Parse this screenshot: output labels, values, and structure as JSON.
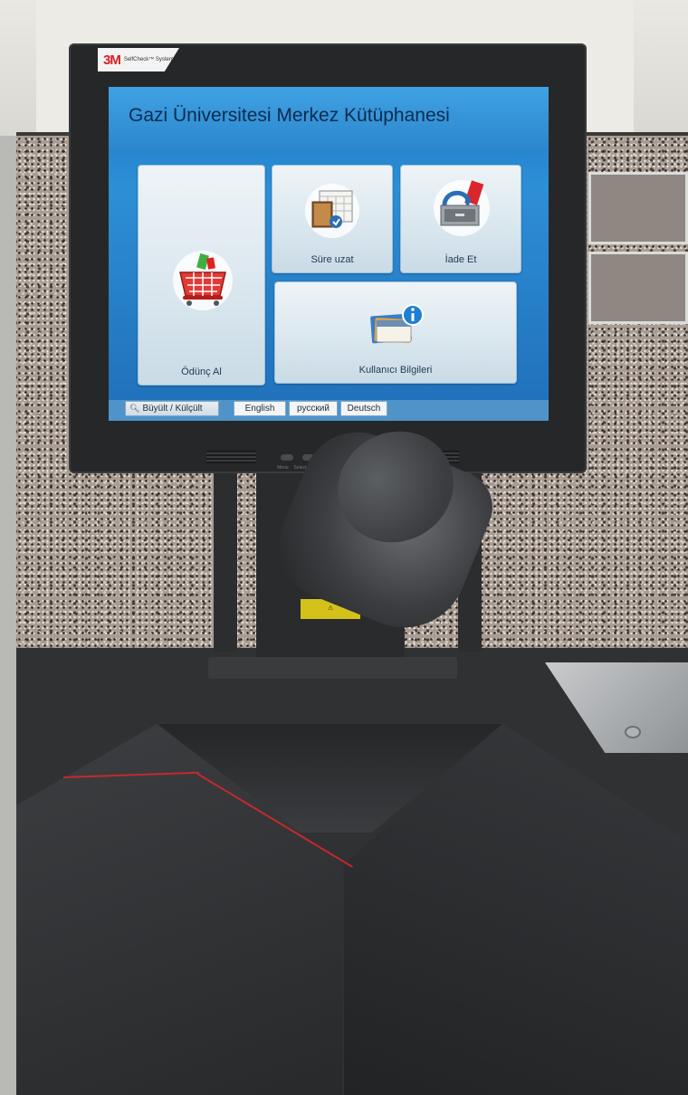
{
  "screen": {
    "title": "Gazi Üniversitesi Merkez Kütüphanesi",
    "tiles": [
      {
        "label": "Ödünç Al",
        "icon": "shopping-basket-icon"
      },
      {
        "label": "Süre uzat",
        "icon": "calendar-book-icon"
      },
      {
        "label": "İade Et",
        "icon": "return-drawer-icon"
      },
      {
        "label": "Kullanıcı Bilgileri",
        "icon": "user-info-icon"
      }
    ],
    "bottom_bar": {
      "zoom": "Büyült / Külçült",
      "languages": [
        "English",
        "русский",
        "Deutsch"
      ]
    }
  },
  "monitor": {
    "logo_mark": "3M",
    "logo_sub": "SelfCheck™ System",
    "buttons": [
      "Menu",
      "Select",
      "–",
      "+"
    ]
  },
  "colors": {
    "screen_blue": "#2c86cd",
    "tile_light": "#e4eef4",
    "brand_red": "#d62021",
    "laser_red": "#e0262a"
  }
}
